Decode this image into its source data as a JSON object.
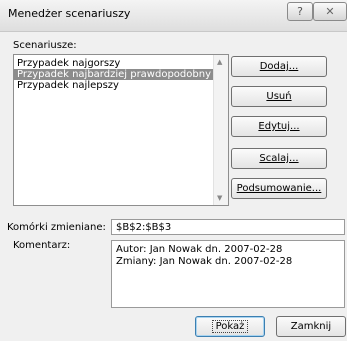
{
  "window": {
    "title": "Menedżer scenariuszy",
    "help_glyph": "?",
    "close_glyph": "✕"
  },
  "scenarios": {
    "label": "Scenariusze:",
    "items": [
      "Przypadek najgorszy",
      "Przypadek najbardziej prawdopodobny",
      "Przypadek najlepszy"
    ],
    "selected_index": 1,
    "scroll_up": "▲",
    "scroll_down": "▼"
  },
  "buttons": {
    "add": "Dodaj...",
    "delete": "Usuń",
    "edit": "Edytuj...",
    "merge": "Scalaj...",
    "summary": "Podsumowanie...",
    "show": "Pokaż",
    "close": "Zamknij"
  },
  "changing_cells": {
    "label": "Komórki zmieniane:",
    "value": "$B$2:$B$3"
  },
  "comment": {
    "label": "Komentarz:",
    "line1": "Autor: Jan Nowak dn. 2007-02-28",
    "line2": "Zmiany: Jan Nowak dn. 2007-02-28"
  }
}
